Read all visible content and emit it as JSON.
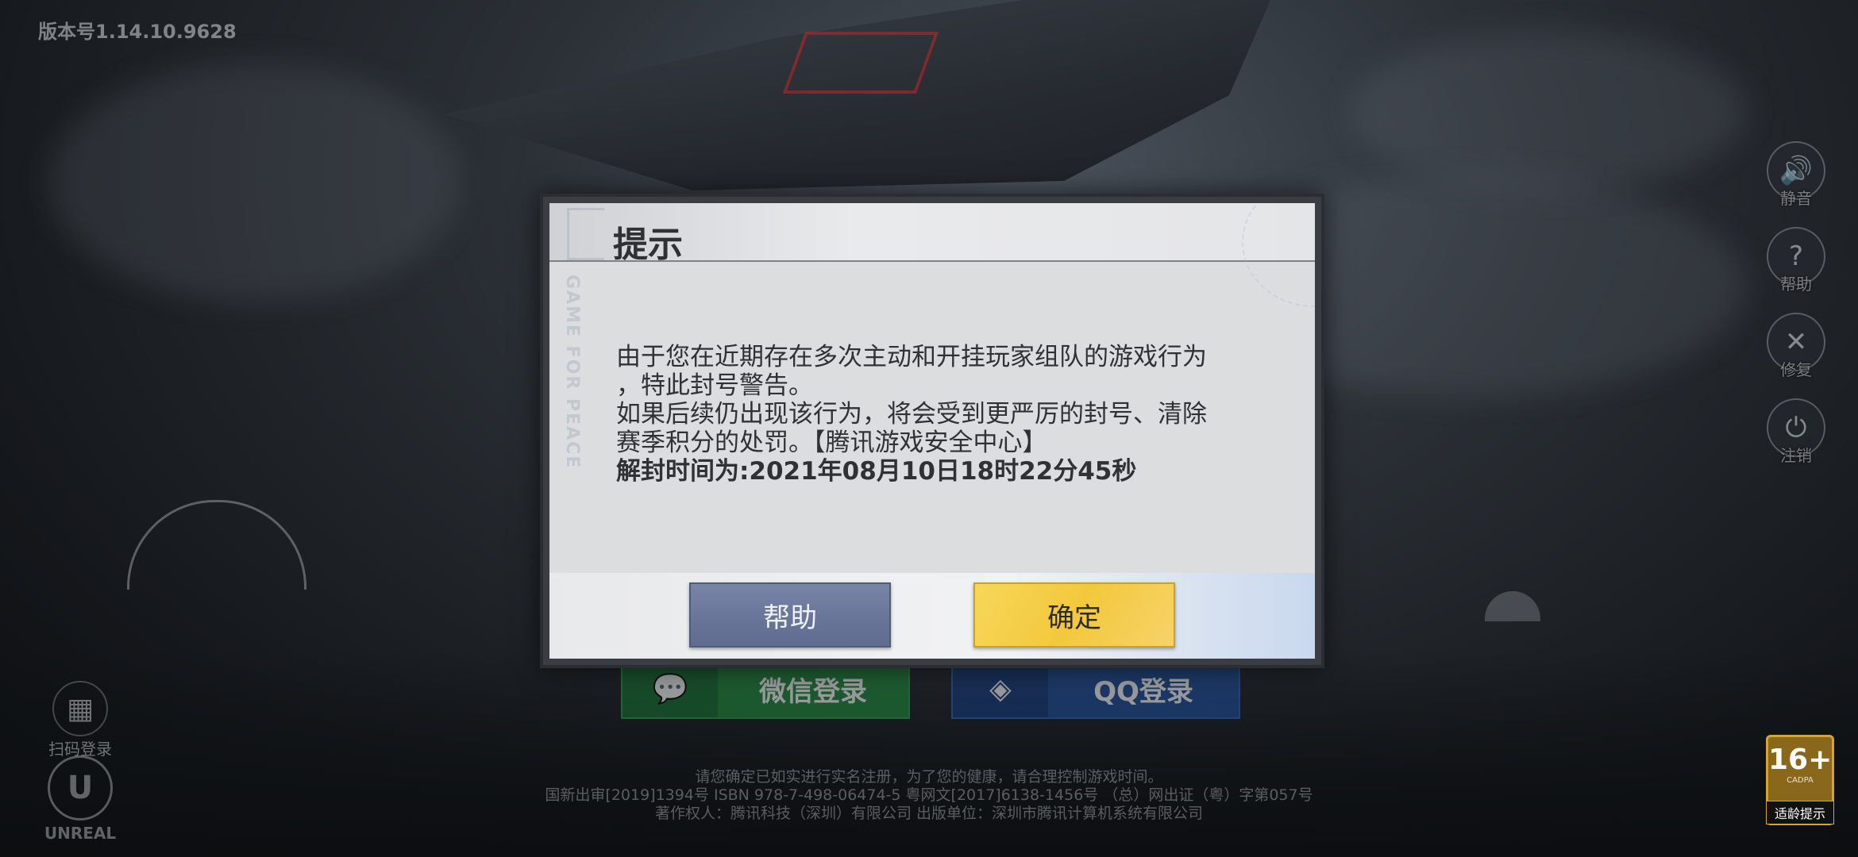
{
  "version_label": "版本号1.14.10.9628",
  "side_buttons": [
    {
      "label": "静音",
      "icon": "speaker-icon"
    },
    {
      "label": "帮助",
      "icon": "question-icon"
    },
    {
      "label": "修复",
      "icon": "wrench-icon"
    },
    {
      "label": "注销",
      "icon": "power-icon"
    }
  ],
  "login": {
    "wechat_label": "微信登录",
    "qq_label": "QQ登录",
    "qr_label": "扫码登录"
  },
  "engine_logo": "UNREAL",
  "age_rating": {
    "value": "16+",
    "org": "CADPA",
    "tip": "适龄提示"
  },
  "footer_lines": [
    "请您确定已如实进行实名注册，为了您的健康，请合理控制游戏时间。",
    "国新出审[2019]1394号  ISBN 978-7-498-06474-5  粤网文[2017]6138-1456号 （总）网出证（粤）字第057号",
    "著作权人：腾讯科技（深圳）有限公司  出版单位：深圳市腾讯计算机系统有限公司"
  ],
  "dialog": {
    "title": "提示",
    "watermark": "GAME FOR PEACE",
    "message_line1": "由于您在近期存在多次主动和开挂玩家组队的游戏行为",
    "message_line2": "，特此封号警告。",
    "message_line3": "如果后续仍出现该行为，将会受到更严厉的封号、清除",
    "message_line4": "赛季积分的处罚。【腾讯游戏安全中心】",
    "unban_time": "解封时间为:2021年08月10日18时22分45秒",
    "help_button": "帮助",
    "ok_button": "确定"
  },
  "colors": {
    "help_button": "#6a7699",
    "ok_button": "#f4c842",
    "dialog_bg": "#dcdddf",
    "wechat": "#1f8a3a",
    "qq": "#1d4c9a"
  }
}
